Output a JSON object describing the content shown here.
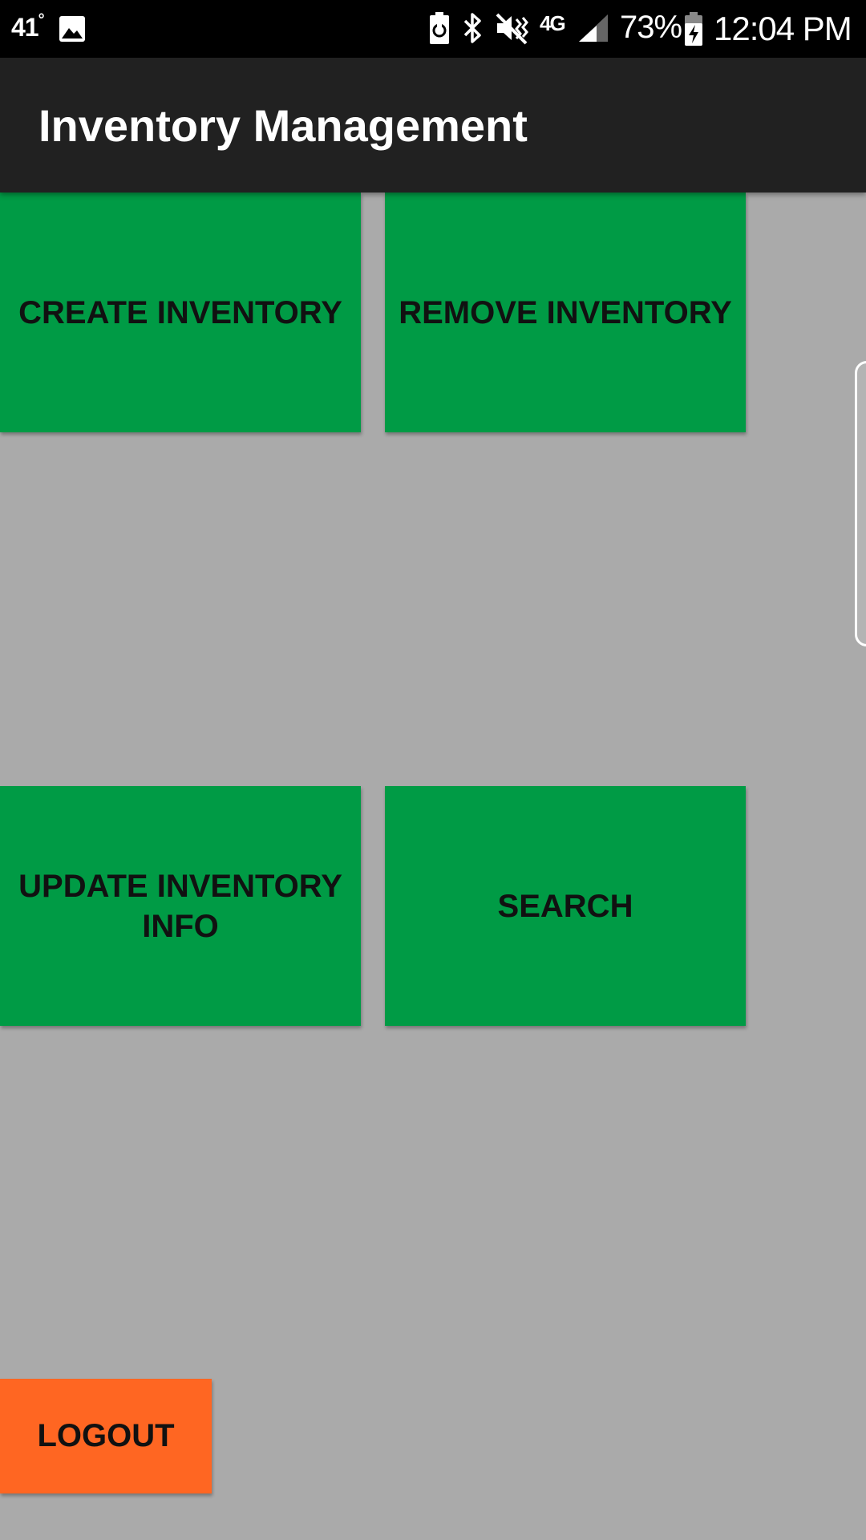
{
  "status_bar": {
    "temperature": "41",
    "degree_symbol": "°",
    "network_label": "4G",
    "battery_percent": "73%",
    "time": "12:04 PM",
    "icons": [
      "image-icon",
      "battery-saver-icon",
      "bluetooth-icon",
      "vibrate-mute-icon",
      "network-4g-lte-icon",
      "signal-icon",
      "battery-charging-icon"
    ]
  },
  "app_bar": {
    "title": "Inventory Management"
  },
  "tiles": {
    "create": "CREATE INVENTORY",
    "remove": "REMOVE INVENTORY",
    "update": "UPDATE INVENTORY INFO",
    "search": "SEARCH"
  },
  "logout_label": "LOGOUT",
  "colors": {
    "background": "#aaaaaa",
    "app_bar": "#212121",
    "status_bar": "#000000",
    "tile_green": "#009b45",
    "logout_orange": "#ff6622"
  }
}
